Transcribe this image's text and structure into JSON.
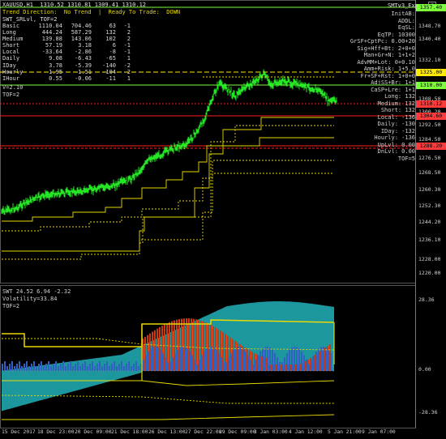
{
  "header": {
    "symbol_line": "XAUUSD,H1  1310.52 1310.81 1309.41 1310.12",
    "trend_line": "Trend Direction:  No Trend  |  Ready To Trade:  DOWN",
    "indicator_line": "SWT_SRLvl, TOF=2"
  },
  "stats_table": [
    [
      "Basic",
      "1110.04",
      "704.46",
      "63",
      "-1"
    ],
    [
      "Long",
      "444.24",
      "587.29",
      "132",
      "2"
    ],
    [
      "Medium",
      "139.88",
      "143.06",
      "102",
      "2"
    ],
    [
      "Short",
      "57.19",
      "3.18",
      "6",
      "-1"
    ],
    [
      "Local",
      "-33.64",
      "-2.86",
      "-8",
      "-1"
    ],
    [
      "Daily",
      "9.08",
      "-6.43",
      "-65",
      "1"
    ],
    [
      "IDay",
      "3.78",
      "-5.39",
      "-140",
      "-2"
    ],
    [
      "Hourly",
      "1.95",
      "-1.51",
      "-104",
      "-2"
    ],
    [
      "IHour",
      "0.55",
      "-0.06",
      "-11",
      "1"
    ]
  ],
  "left_lines": [
    "V=2.10",
    "TOF=2"
  ],
  "right_panel": {
    "title": "SMTv3_Exp",
    "lines": [
      "InitAB:",
      "ADDL:",
      "EqSL:",
      "EqTP: 10300",
      "GrSF+CptPc: 0.00+20",
      "Sig+Hff+Bt: 2+0+0",
      "Man+Gr+N: 1+1+2",
      "AdvMM+Lot: 0+0.10",
      "Amm+Risk: 1+5.0",
      "Fr+SF+Rst: 1+0+0",
      "AdjSS+Br: 1+1",
      "CaSP+Lre: 1+1",
      "Long: 132",
      "Medium: 132",
      "Short: 132",
      "Local: -136",
      "Daily: -130",
      "IDay: -132",
      "Hourly: -136",
      "UpLvl: 0.00",
      "DnLvl: 0.00",
      "TOF=5"
    ]
  },
  "price_axis": [
    "1357.40",
    "1348.70",
    "1340.40",
    "1332.10",
    "1316.80",
    "1308.50",
    "1300.20",
    "1292.50",
    "1284.50",
    "1276.50",
    "1268.50",
    "1260.30",
    "1252.30",
    "1244.20",
    "1236.10",
    "1228.00",
    "1220.00"
  ],
  "price_tags": [
    {
      "text": "1357.40",
      "color": "#7dff3a"
    },
    {
      "text": "1325.00",
      "color": "#ffe900"
    },
    {
      "text": "1310.00",
      "color": "#7dff3a"
    },
    {
      "text": "1310.12",
      "color": "#ff3a3a"
    },
    {
      "text": "1304.60",
      "color": "#ff3a3a"
    },
    {
      "text": "1288.20",
      "color": "#ff3a3a"
    }
  ],
  "sub_header": "SWT 24.52 6.94 -2.32",
  "sub_lines": [
    "Volatility=33.84",
    "TOF=2"
  ],
  "sub_axis": [
    "28.36",
    "0.00",
    "-28.36"
  ],
  "time_axis": [
    "15 Dec 2017",
    "18 Dec 23:00",
    "20 Dec 09:00",
    "21 Dec 18:00",
    "26 Dec 13:00",
    "27 Dec 22:00",
    "29 Dec 09:00",
    "3 Jan 03:00",
    "4 Jan 12:00",
    "5 Jan 21:00",
    "9 Jan 07:00"
  ],
  "colors": {
    "bull": "#2aff2a",
    "bear": "#2aff2a",
    "yellow": "#e8d800",
    "teal": "#1f9fa6",
    "red": "#c83a14",
    "blue": "#3060c0",
    "redline": "#ff2020"
  }
}
